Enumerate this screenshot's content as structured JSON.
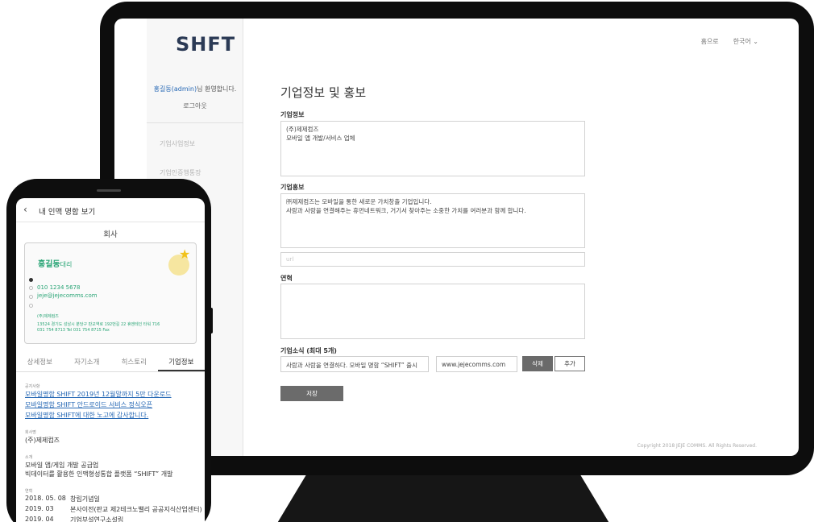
{
  "desktop": {
    "logo": {
      "text": "SHFT"
    },
    "sidebar": {
      "welcome_user": "홍길동(admin)",
      "welcome_suffix": "님 환영합니다.",
      "logout": "로그아웃",
      "menu": [
        "기업사업정보",
        "기업인증행통장"
      ]
    },
    "topnav": {
      "home": "홈으로",
      "language": "한국어 ⌄"
    },
    "title": "기업정보 및 홍보",
    "company_info": {
      "label": "기업정보",
      "lines": [
        "(주)제제컴즈",
        "모바일 앱 개발/서비스 업체"
      ]
    },
    "promotion": {
      "label": "기업홍보",
      "lines": [
        "㈜제제컴즈는 모바일을 통한 새로운 가치창출 기업입니다.",
        "사람과 사람을 연결해주는 휴먼네트워크, 거기서 찾아주는 소중한 가치를 여러분과 함께 합니다."
      ]
    },
    "url_placeholder": "url",
    "history": {
      "label": "연혁"
    },
    "news": {
      "label": "기업소식 (최대 5개)",
      "text": "사람과 사람을 연결하다. 모바일 명함 “SHIFT” 출시",
      "url": "www.jejecomms.com",
      "delete_label": "삭제",
      "add_label": "추가"
    },
    "save_label": "저장",
    "copyright": "Copyright 2018 JEJE COMMS. All Rights Reserved."
  },
  "mobile": {
    "header_title": "내 인맥 명함 보기",
    "section_title": "회사",
    "card": {
      "name": "홍길동",
      "position": "대리",
      "phone": "010 1234 5678",
      "email": "jeje@jejecomms.com",
      "company": "(주)제제컴즈",
      "address": "13524 경기도 성남시 분당구 판교역로 192번길 22 휴엔테인 타워 716",
      "contact": "031 754 8713 Tel  031 754 8715 Fax"
    },
    "tabs": [
      "상세정보",
      "자기소개",
      "히스토리",
      "기업정보"
    ],
    "news_label": "공지사항",
    "news": [
      "모바일명함 SHIFT 2019년 12월말까지 5만 다운로드",
      "모바일명함 SHIFT 안드로이드 서비스 정식오픈",
      "모바일명함 SHIFT에 대한 노고에 감사합니다."
    ],
    "company_label": "회사명",
    "company_name": "(주)제제컴즈",
    "intro_label": "소개",
    "intro": [
      "모바일 앱/게임 개발 공급업",
      "빅데이터를 활용한 인맥형성통합 플랫폼 “SHIFT” 개발"
    ],
    "history_label": "연혁",
    "history": [
      {
        "date": "2018. 05. 08",
        "event": "창립기념일"
      },
      {
        "date": "2019. 03",
        "event": "본사이전(판교 제2테크노밸리 공공지식산업센터)"
      },
      {
        "date": "2019. 04",
        "event": "기업부설연구소설립"
      }
    ]
  }
}
